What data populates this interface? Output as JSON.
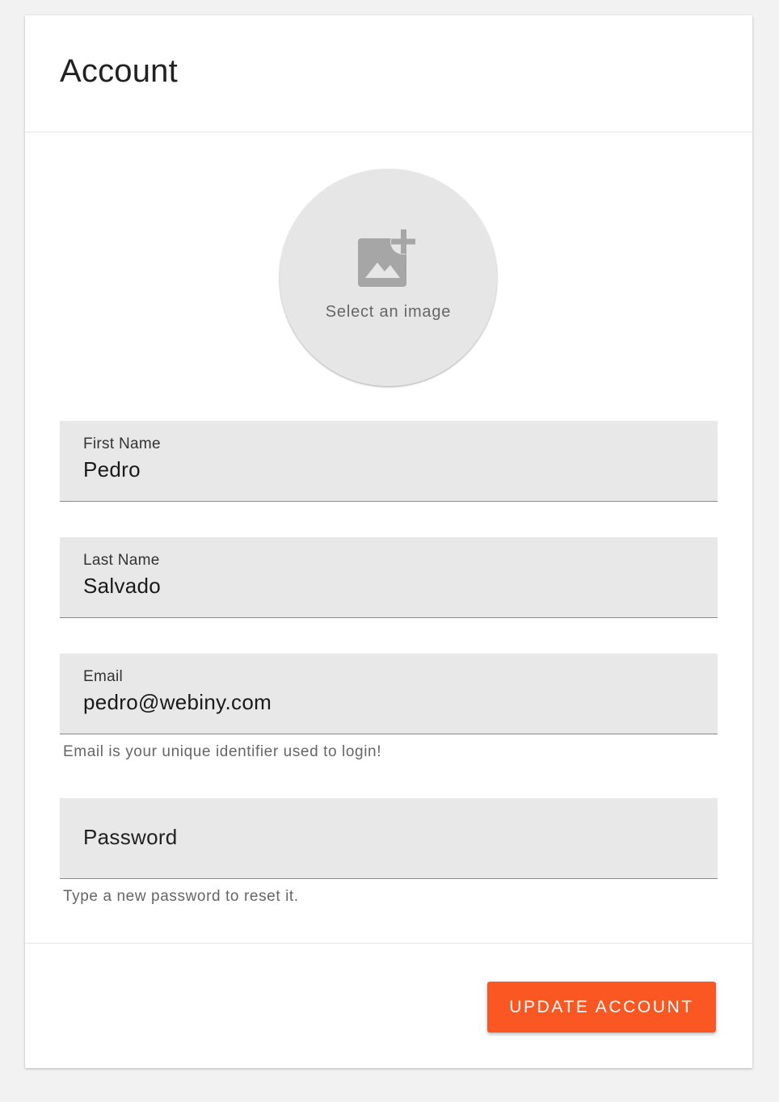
{
  "header": {
    "title": "Account"
  },
  "avatar": {
    "icon": "add-photo-icon",
    "label": "Select an image"
  },
  "fields": {
    "first_name": {
      "label": "First Name",
      "value": "Pedro"
    },
    "last_name": {
      "label": "Last Name",
      "value": "Salvado"
    },
    "email": {
      "label": "Email",
      "value": "pedro@webiny.com",
      "helper": "Email is your unique identifier used to login!"
    },
    "password": {
      "label": "Password",
      "value": "",
      "helper": "Type a new password to reset it."
    }
  },
  "footer": {
    "submit_label": "UPDATE ACCOUNT"
  },
  "colors": {
    "accent": "#fa5723",
    "field_background": "#e8e8e8",
    "page_background": "#f2f2f2"
  }
}
